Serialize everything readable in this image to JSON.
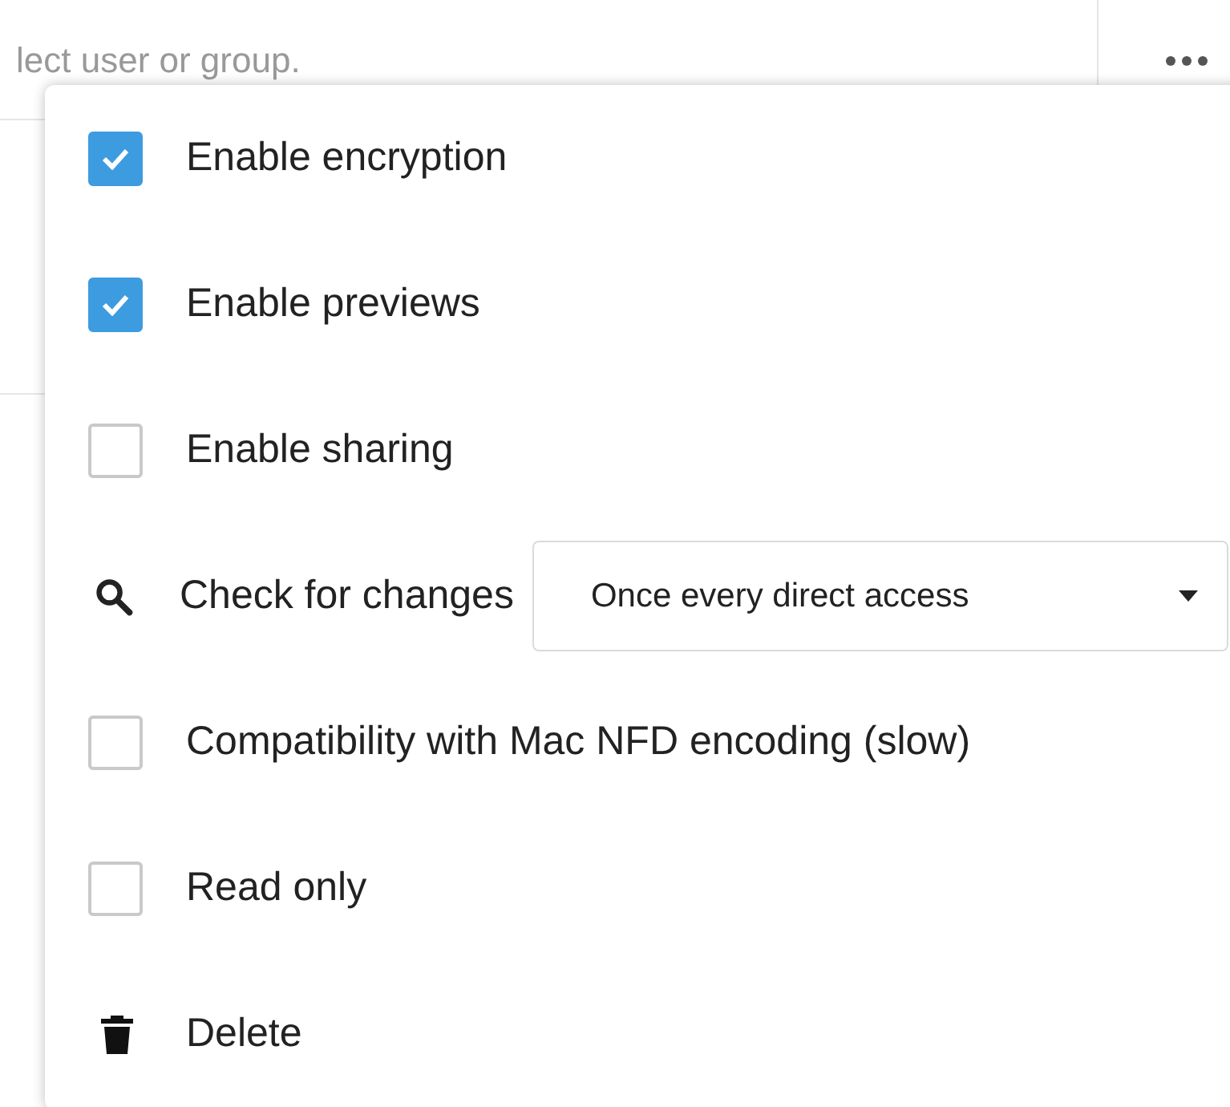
{
  "share_field": {
    "placeholder": "lect user or group."
  },
  "menu": {
    "items": [
      {
        "kind": "checkbox",
        "label": "Enable encryption",
        "checked": true
      },
      {
        "kind": "checkbox",
        "label": "Enable previews",
        "checked": true
      },
      {
        "kind": "checkbox",
        "label": "Enable sharing",
        "checked": false
      },
      {
        "kind": "select",
        "label": "Check for changes",
        "value": "Once every direct access"
      },
      {
        "kind": "checkbox",
        "label": "Compatibility with Mac NFD encoding (slow)",
        "checked": false
      },
      {
        "kind": "checkbox",
        "label": "Read only",
        "checked": false
      },
      {
        "kind": "action",
        "label": "Delete"
      }
    ]
  }
}
